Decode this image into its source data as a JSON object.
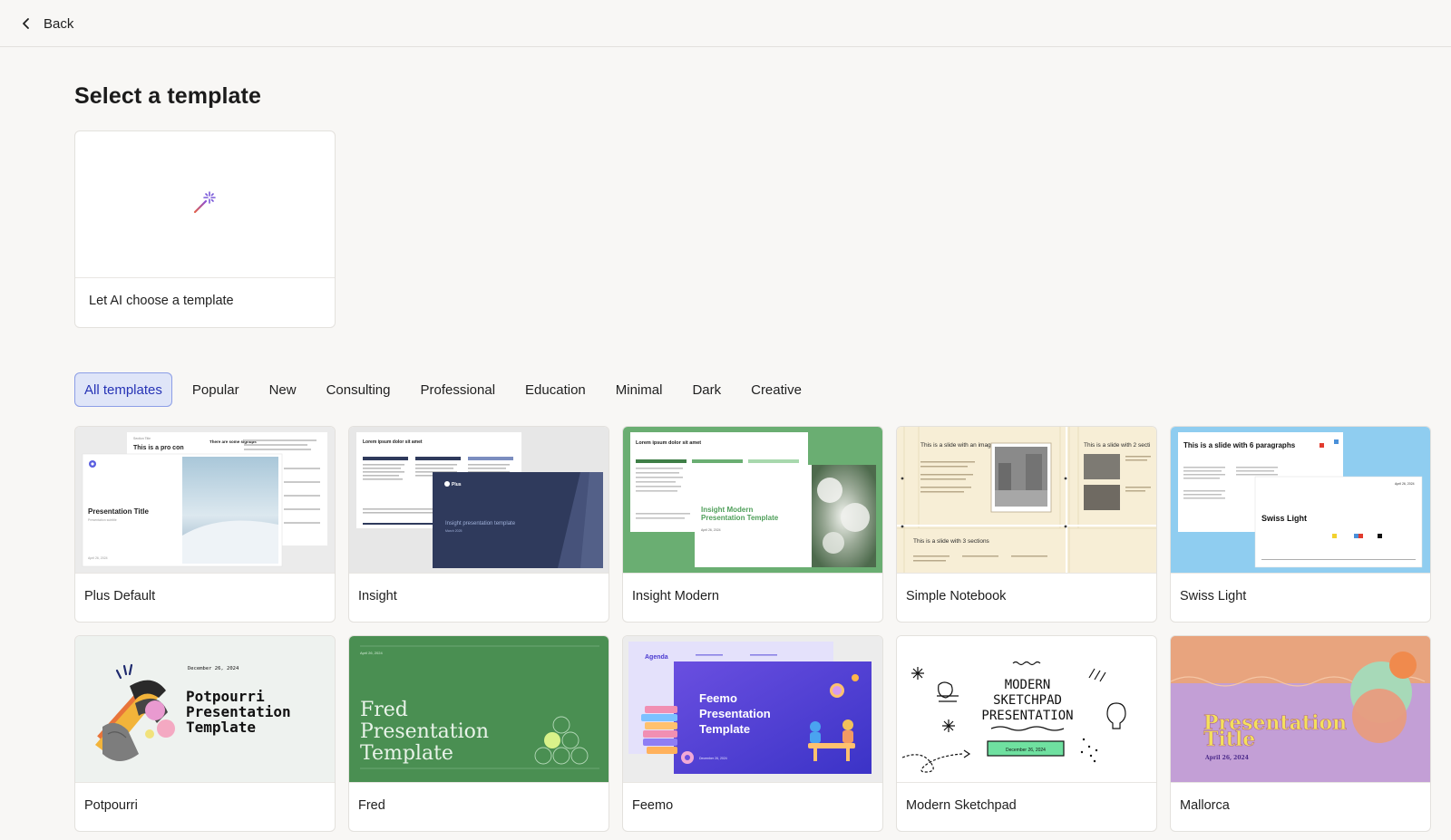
{
  "header": {
    "back_label": "Back"
  },
  "page": {
    "title": "Select a template"
  },
  "ai_card": {
    "label": "Let AI choose a template"
  },
  "tabs": [
    {
      "label": "All templates",
      "active": true
    },
    {
      "label": "Popular"
    },
    {
      "label": "New"
    },
    {
      "label": "Consulting"
    },
    {
      "label": "Professional"
    },
    {
      "label": "Education"
    },
    {
      "label": "Minimal"
    },
    {
      "label": "Dark"
    },
    {
      "label": "Creative"
    }
  ],
  "templates": [
    {
      "name": "Plus Default",
      "preview": {
        "title": "Presentation Title",
        "subtitle": "Presentation subtitle",
        "date": "April 26, 2024",
        "back_title": "This is a pro con",
        "back_heading": "There are some signups"
      }
    },
    {
      "name": "Insight",
      "preview": {
        "back_title": "Lorem ipsum dolor sit amet",
        "brand": "Plus",
        "title": "Insight presentation template",
        "date": "March 2025"
      }
    },
    {
      "name": "Insight Modern",
      "preview": {
        "back_title": "Lorem ipsum dolor sit amet",
        "title_line1": "Insight Modern",
        "title_line2": "Presentation Template",
        "date": "April 26, 2024"
      }
    },
    {
      "name": "Simple Notebook",
      "preview": {
        "slide1": "This is a slide with an image",
        "slide2": "This is a slide with 2 secti",
        "slide3": "This is a slide with 3 sections"
      }
    },
    {
      "name": "Swiss Light",
      "preview": {
        "back_title": "This is a slide with 6 paragraphs",
        "title": "Swiss Light",
        "date": "April 26, 2024"
      }
    },
    {
      "name": "Potpourri",
      "preview": {
        "date": "December 26, 2024",
        "line1": "Potpourri",
        "line2": "Presentation",
        "line3": "Template"
      }
    },
    {
      "name": "Fred",
      "preview": {
        "date": "April 26, 2024",
        "line1": "Fred",
        "line2": "Presentation",
        "line3": "Template"
      }
    },
    {
      "name": "Feemo",
      "preview": {
        "back_title": "Agenda",
        "line1": "Feemo",
        "line2": "Presentation",
        "line3": "Template",
        "date": "December 26, 2024"
      }
    },
    {
      "name": "Modern Sketchpad",
      "preview": {
        "line1": "MODERN",
        "line2": "SKETCHPAD",
        "line3": "PRESENTATION",
        "date": "December 26, 2024"
      }
    },
    {
      "name": "Mallorca",
      "preview": {
        "line1": "Presentation",
        "line2": "Title",
        "date": "April 26, 2024"
      }
    }
  ],
  "colors": {
    "accent": "#2633b5",
    "tab_active_bg": "#dfe5f8",
    "insight_navy": "#2f3a5c",
    "insight_modern_green": "#6aae72",
    "fred_green": "#4a8f52",
    "feemo_purple": "#5a3fd6",
    "swiss_blue": "#8fcdf0",
    "mallorca_orange": "#e8a47e",
    "mallorca_purple": "#c39fd6"
  }
}
